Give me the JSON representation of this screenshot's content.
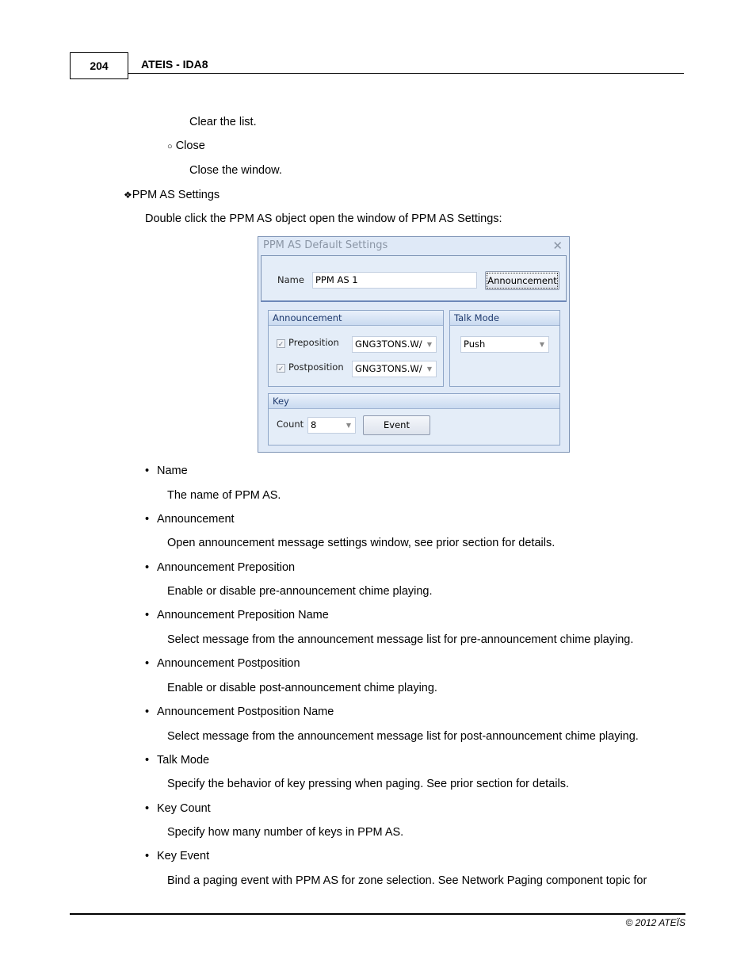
{
  "header": {
    "page_number": "204",
    "doc_title": "ATEIS - IDA8"
  },
  "intro": {
    "clear_desc": "Clear the list.",
    "close_bullet": "○",
    "close_label": "Close",
    "close_desc": "Close the window.",
    "section_bullet": "❖",
    "section_title": "PPM AS Settings",
    "section_desc": "Double click the PPM AS object open the window of PPM AS Settings:"
  },
  "dialog": {
    "title": "PPM AS Default Settings",
    "close_glyph": "✕",
    "name_label": "Name",
    "name_value": "PPM AS 1",
    "announcement_button": "Announcement",
    "announcement_group": {
      "title": "Announcement",
      "preposition_label": "Preposition",
      "preposition_checked": true,
      "preposition_value": "GNG3TONS.W/",
      "postposition_label": "Postposition",
      "postposition_checked": true,
      "postposition_value": "GNG3TONS.W/"
    },
    "talk_mode_group": {
      "title": "Talk Mode",
      "value": "Push"
    },
    "key_group": {
      "title": "Key",
      "count_label": "Count",
      "count_value": "8",
      "event_button": "Event"
    },
    "check_glyph": "✓",
    "arrow_glyph": "▼"
  },
  "items": [
    {
      "term": "Name",
      "desc": "The name of PPM AS."
    },
    {
      "term": "Announcement",
      "desc": "Open announcement message settings window, see prior section for details."
    },
    {
      "term": "Announcement Preposition",
      "desc": "Enable or disable pre-announcement chime playing."
    },
    {
      "term": "Announcement Preposition Name",
      "desc": "Select message from the announcement message list for pre-announcement chime playing."
    },
    {
      "term": "Announcement Postposition",
      "desc": "Enable or disable post-announcement chime playing."
    },
    {
      "term": "Announcement Postposition Name",
      "desc": "Select message from the announcement message list for post-announcement chime playing."
    },
    {
      "term": "Talk Mode",
      "desc": "Specify the behavior of key pressing when paging. See prior section for details."
    },
    {
      "term": "Key Count",
      "desc": "Specify how many number of keys in PPM AS."
    },
    {
      "term": "Key Event",
      "desc": "Bind a paging event with PPM AS for zone selection. See Network Paging component topic for"
    }
  ],
  "bullet_glyph": "•",
  "footer": {
    "copyright": "© 2012 ATEÏS"
  }
}
